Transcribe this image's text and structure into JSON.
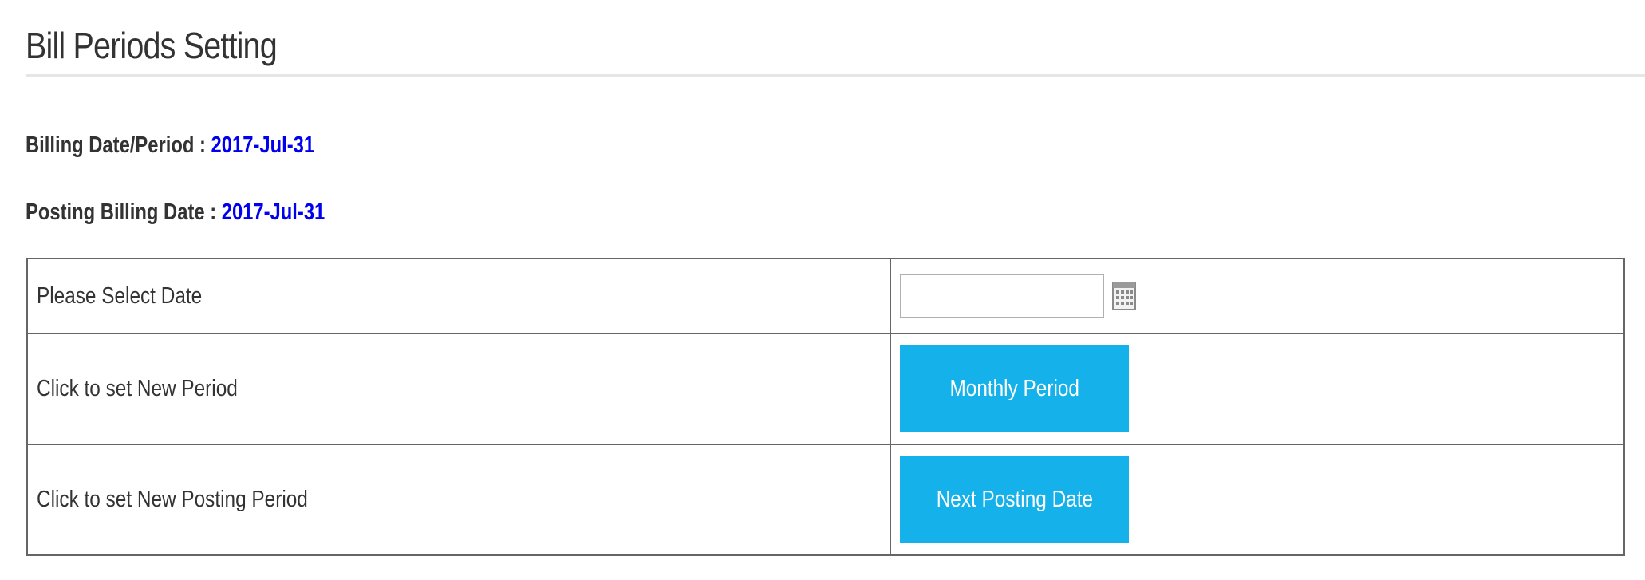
{
  "header": {
    "title": "Bill Periods Setting"
  },
  "info": {
    "billing_label": "Billing Date/Period : ",
    "billing_value": "2017-Jul-31",
    "posting_label": "Posting Billing Date : ",
    "posting_value": "2017-Jul-31",
    "value_color": "#0000ee"
  },
  "table": {
    "rows": [
      {
        "label": "Please Select Date"
      },
      {
        "label": "Click to set New Period"
      },
      {
        "label": "Click to set New Posting Period"
      }
    ],
    "date_input": {
      "value": "",
      "placeholder": ""
    },
    "buttons": {
      "monthly_period": "Monthly Period",
      "next_posting_date": "Next Posting Date"
    },
    "icons": {
      "calendar": "calendar-icon"
    }
  },
  "colors": {
    "button_background": "#14b1ea",
    "button_text": "#ffffff",
    "border": "#666666"
  }
}
